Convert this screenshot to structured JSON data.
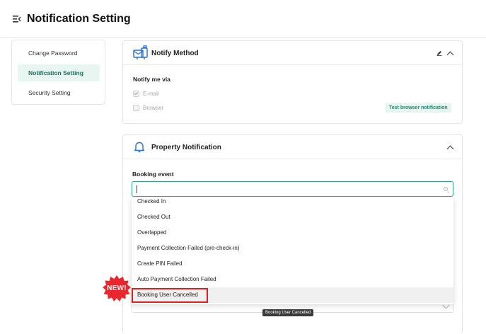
{
  "header": {
    "title": "Notification Setting",
    "icon": "menu-collapse-icon"
  },
  "sidebar": {
    "items": [
      {
        "label": "Change Password",
        "active": false
      },
      {
        "label": "Notification Setting",
        "active": true
      },
      {
        "label": "Security Setting",
        "active": false
      }
    ]
  },
  "notify_method": {
    "title": "Notify Method",
    "icon": "mailbox-icon",
    "section_label": "Notify me via",
    "options": [
      {
        "label": "E-mail",
        "checked": true
      },
      {
        "label": "Browser",
        "checked": false
      }
    ],
    "test_button": "Test browser notification"
  },
  "property_notification": {
    "title": "Property Notification",
    "icon": "bell-icon",
    "field_label": "Booking event",
    "search_value": "",
    "dropdown_options": [
      "Checked In",
      "Checked Out",
      "Overlapped",
      "Payment Collection Failed (pre-check-in)",
      "Create PIN Failed",
      "Auto Payment Collection Failed",
      "Booking User Cancelled"
    ],
    "highlighted_option": "Booking User Cancelled",
    "tooltip": "Booking User Cancelled"
  },
  "new_badge": {
    "text": "NEW!",
    "color": "#e8262c"
  },
  "colors": {
    "accent": "#2fa68a",
    "highlight_box": "#e02020"
  }
}
